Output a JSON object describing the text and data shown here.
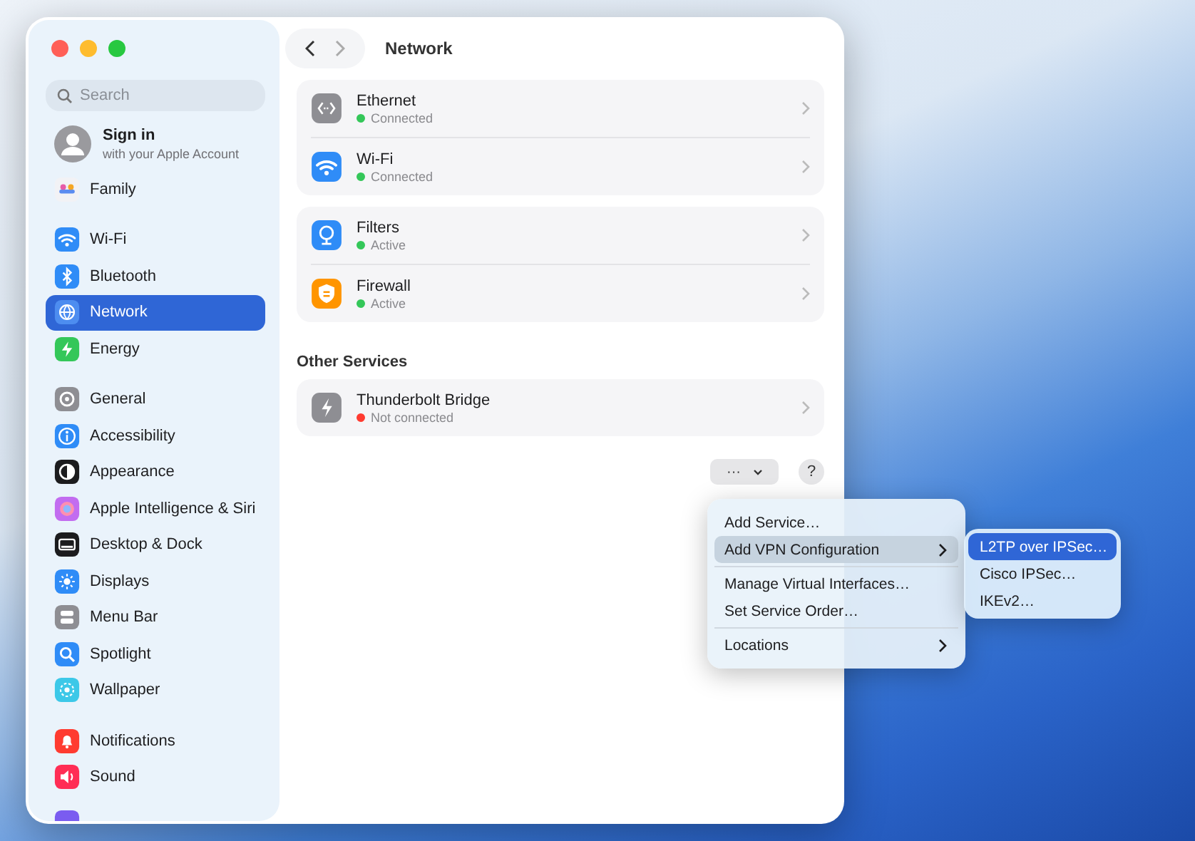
{
  "window": {
    "title": "Network"
  },
  "sidebar": {
    "search": {
      "placeholder": "Search"
    },
    "account": {
      "title": "Sign in",
      "subtitle": "with your Apple Account"
    },
    "groups": [
      [
        {
          "label": "Family",
          "kind": "family",
          "selected": false
        }
      ],
      [
        {
          "label": "Wi-Fi",
          "kind": "wifi",
          "selected": false
        },
        {
          "label": "Bluetooth",
          "kind": "bluetooth",
          "selected": false
        },
        {
          "label": "Network",
          "kind": "globe",
          "selected": true
        },
        {
          "label": "Energy",
          "kind": "bolt",
          "selected": false
        }
      ],
      [
        {
          "label": "General",
          "kind": "gear",
          "selected": false
        },
        {
          "label": "Accessibility",
          "kind": "accessibility",
          "selected": false
        },
        {
          "label": "Appearance",
          "kind": "appearance",
          "selected": false
        },
        {
          "label": "Apple Intelligence & Siri",
          "kind": "siri",
          "selected": false
        },
        {
          "label": "Desktop & Dock",
          "kind": "dock",
          "selected": false
        },
        {
          "label": "Displays",
          "kind": "sun",
          "selected": false
        },
        {
          "label": "Menu Bar",
          "kind": "menubar",
          "selected": false
        },
        {
          "label": "Spotlight",
          "kind": "search",
          "selected": false
        },
        {
          "label": "Wallpaper",
          "kind": "flower",
          "selected": false
        }
      ],
      [
        {
          "label": "Notifications",
          "kind": "bell",
          "selected": false
        },
        {
          "label": "Sound",
          "kind": "speaker",
          "selected": false
        }
      ]
    ]
  },
  "services": [
    {
      "items": [
        {
          "name": "Ethernet",
          "kind": "ethernet",
          "status": "Connected",
          "color": "#34c759"
        },
        {
          "name": "Wi-Fi",
          "kind": "wifi",
          "status": "Connected",
          "color": "#34c759"
        }
      ]
    },
    {
      "items": [
        {
          "name": "Filters",
          "kind": "filter",
          "status": "Active",
          "color": "#34c759"
        },
        {
          "name": "Firewall",
          "kind": "shield",
          "status": "Active",
          "color": "#34c759"
        }
      ]
    }
  ],
  "other_services": {
    "heading": "Other Services",
    "items": [
      {
        "name": "Thunderbolt Bridge",
        "kind": "thunderbolt",
        "status": "Not connected",
        "color": "#ff3b30"
      }
    ]
  },
  "toolbar": {
    "more_button": "···",
    "help_button": "?"
  },
  "menu": {
    "groups": [
      [
        {
          "label": "Add Service…",
          "submenu": false,
          "selected": false
        },
        {
          "label": "Add VPN Configuration",
          "submenu": true,
          "selected": true
        }
      ],
      [
        {
          "label": "Manage Virtual Interfaces…",
          "submenu": false,
          "selected": false
        },
        {
          "label": "Set Service Order…",
          "submenu": false,
          "selected": false
        }
      ],
      [
        {
          "label": "Locations",
          "submenu": true,
          "selected": false
        }
      ]
    ]
  },
  "submenu": {
    "items": [
      {
        "label": "L2TP over IPSec…",
        "selected": true
      },
      {
        "label": "Cisco IPSec…",
        "selected": false
      },
      {
        "label": "IKEv2…",
        "selected": false
      }
    ]
  }
}
